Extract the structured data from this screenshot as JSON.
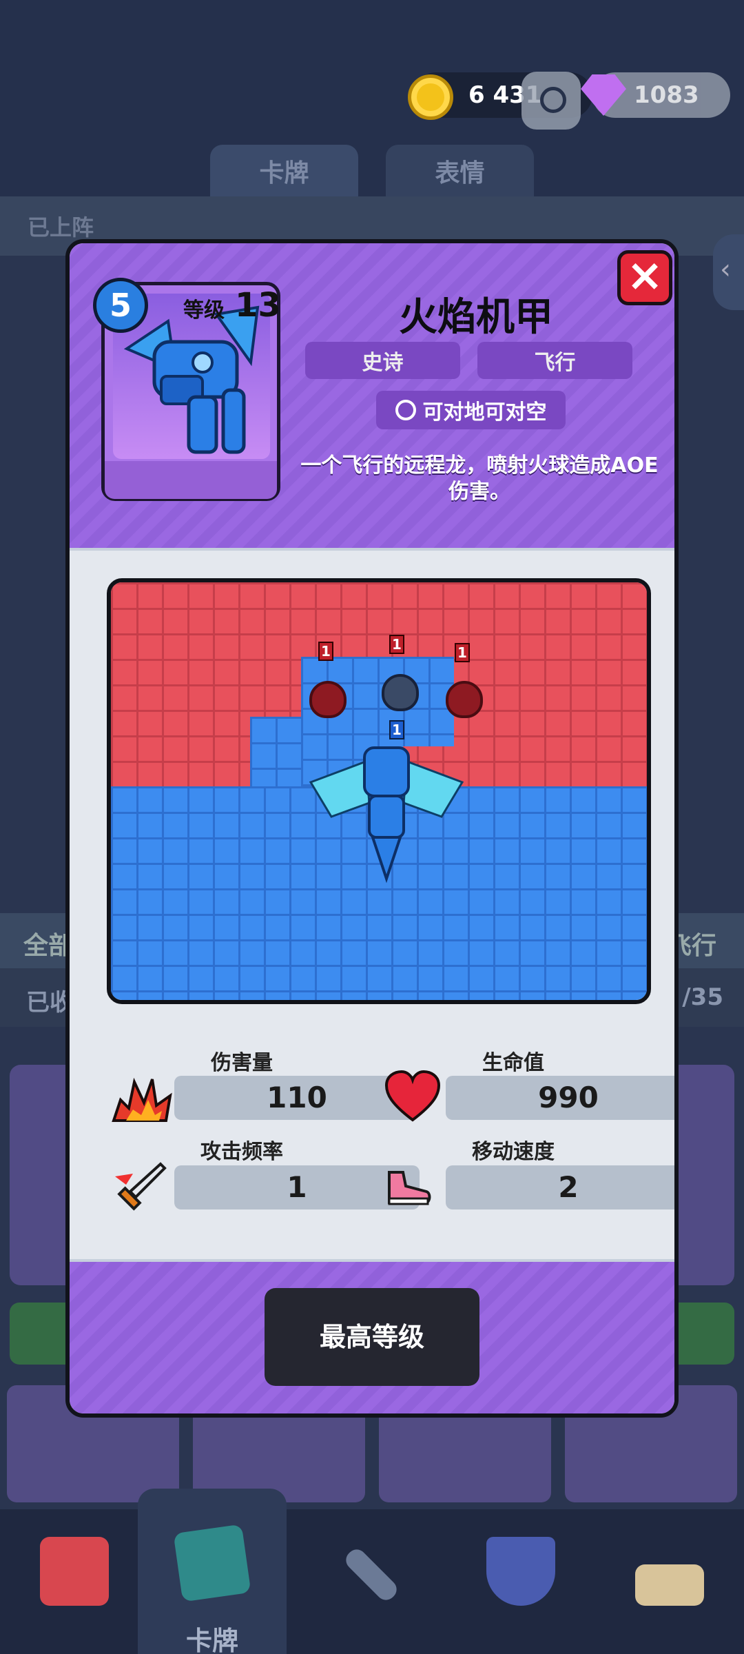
{
  "currency": {
    "coins": "6 431",
    "gems": "1083"
  },
  "tabs": [
    {
      "label": "卡牌"
    },
    {
      "label": "表情"
    }
  ],
  "lineup_title": "已上阵",
  "filter": {
    "left": "全部",
    "right": "飞行"
  },
  "collected": {
    "left": "已收",
    "right": "/35"
  },
  "card": {
    "cost": "5",
    "level_label": "等级",
    "level": "13",
    "name": "火焰机甲",
    "rarity": "史诗",
    "type": "飞行",
    "targets": "可对地可对空",
    "description": "一个飞行的远程龙，喷射火球造成AOE伤害。"
  },
  "arena_labels": {
    "enemy_hp": "1",
    "unit_hp": "1"
  },
  "stats": {
    "damage": {
      "label": "伤害量",
      "value": "110"
    },
    "health": {
      "label": "生命值",
      "value": "990"
    },
    "attack_rate": {
      "label": "攻击频率",
      "value": "1"
    },
    "move_speed": {
      "label": "移动速度",
      "value": "2"
    }
  },
  "max_level_button": "最高等级",
  "bottom_nav": {
    "cards_label": "卡牌"
  },
  "icons": {
    "coin": "coin-icon",
    "gem": "gem-icon",
    "profile": "profile-icon",
    "close": "close-icon",
    "damage": "explosion-icon",
    "health": "heart-icon",
    "attack_rate": "sword-icon",
    "move_speed": "shoe-icon",
    "targets": "crosshair-icon"
  },
  "colors": {
    "epic": "#9a68e2",
    "close": "#e5283a",
    "red_zone": "#e8515c",
    "blue_zone": "#3d8cf0"
  }
}
